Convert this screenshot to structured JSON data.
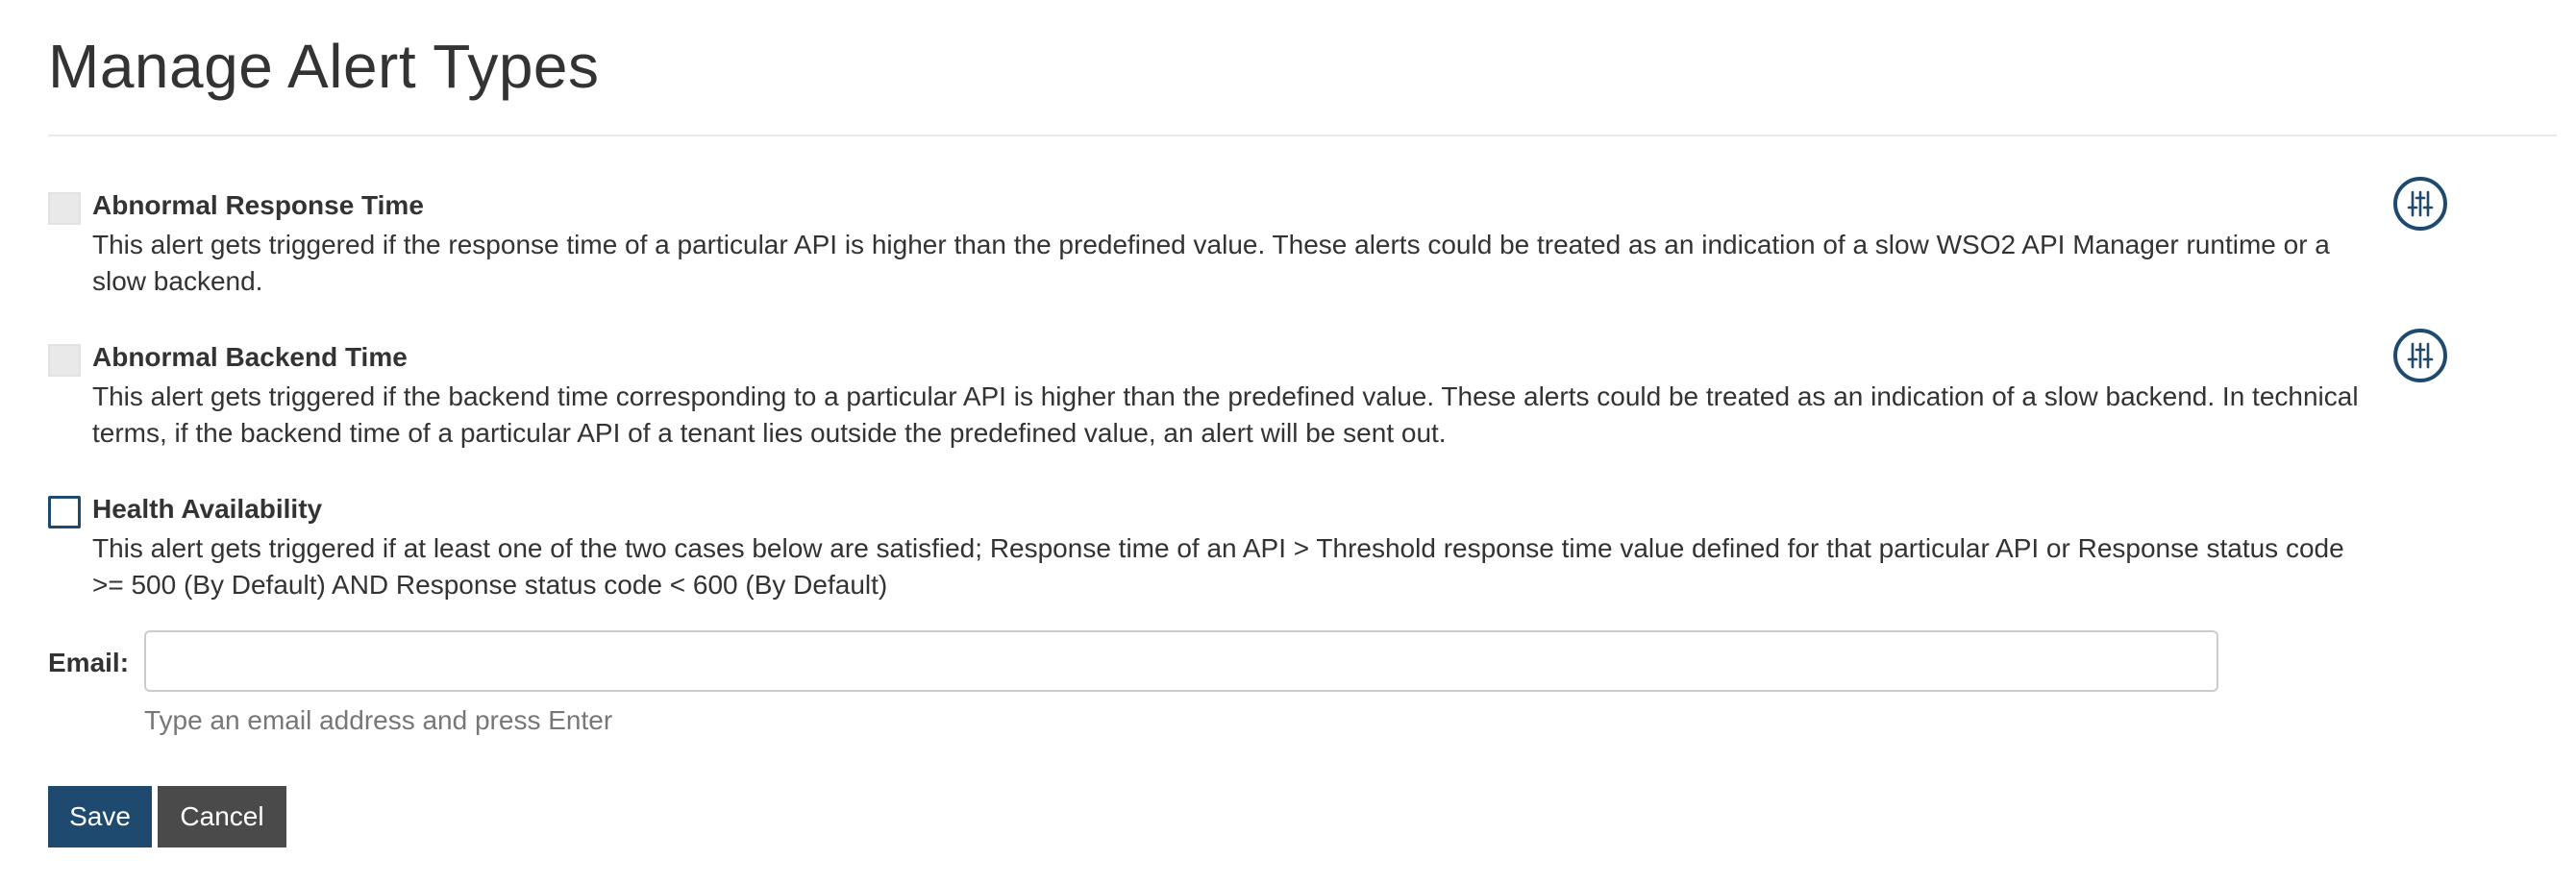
{
  "page": {
    "title": "Manage Alert Types"
  },
  "alerts": [
    {
      "name": "Abnormal Response Time",
      "description": "This alert gets triggered if the response time of a particular API is higher than the predefined value. These alerts could be treated as an indication of a slow WSO2 API Manager runtime or a slow backend.",
      "checkbox_state": "disabled-unchecked",
      "has_config_button": true,
      "config_icon": "sliders-icon"
    },
    {
      "name": "Abnormal Backend Time",
      "description": "This alert gets triggered if the backend time corresponding to a particular API is higher than the predefined value. These alerts could be treated as an indication of a slow backend. In technical terms, if the backend time of a particular API of a tenant lies outside the predefined value, an alert will be sent out.",
      "checkbox_state": "disabled-unchecked",
      "has_config_button": true,
      "config_icon": "sliders-icon"
    },
    {
      "name": "Health Availability",
      "description": "This alert gets triggered if at least one of the two cases below are satisfied; Response time of an API > Threshold response time value defined for that particular API or Response status code >= 500 (By Default) AND Response status code < 600 (By Default)",
      "checkbox_state": "unchecked",
      "has_config_button": false
    }
  ],
  "email": {
    "label": "Email:",
    "value": "",
    "helper_text": "Type an email address and press Enter"
  },
  "actions": {
    "save_label": "Save",
    "cancel_label": "Cancel"
  },
  "colors": {
    "primary": "#1d4a6e",
    "secondary": "#4a4a4a",
    "text": "#333333",
    "helper_text": "#777777",
    "divider": "#eaeaea"
  }
}
